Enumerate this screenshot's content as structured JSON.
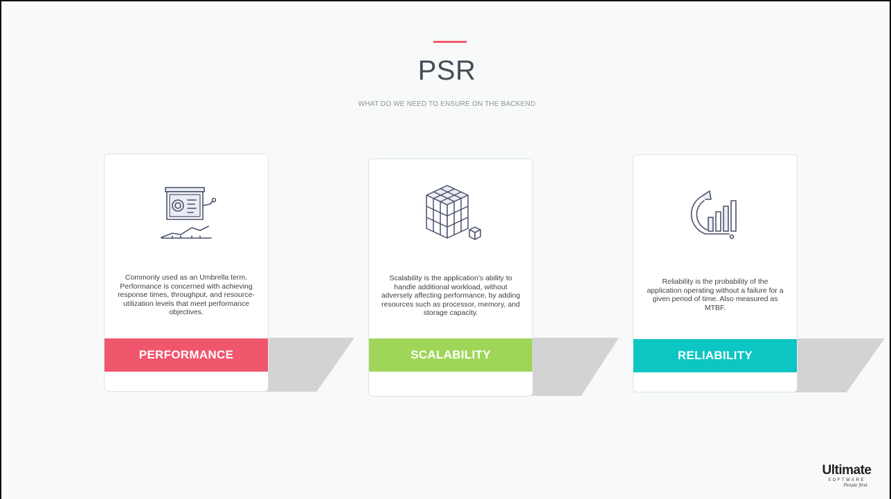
{
  "header": {
    "title": "PSR",
    "subtitle": "WHAT DO WE NEED TO ENSURE ON THE BACKEND",
    "accent_color": "#f0596e"
  },
  "cards": [
    {
      "label": "PERFORMANCE",
      "icon": "presentation-board-icon",
      "color": "#f0566c",
      "description": "Commonly used as an Umbrella term. Performance is concerned with achieving response times, throughput, and resource-utilization levels that meet performance objectives."
    },
    {
      "label": "SCALABILITY",
      "icon": "cube-grid-icon",
      "color": "#9fd65a",
      "description": "Scalability is the application’s ability to handle additional workload, without adversely affecting performance, by adding resources such as processor, memory, and storage capacity."
    },
    {
      "label": "RELIABILITY",
      "icon": "growth-chart-icon",
      "color": "#0cc6c3",
      "description": "Reliability is the probability of the application operating without a failure for a given period of time. Also measured as MTBF."
    }
  ],
  "logo": {
    "brand": "Ultimate",
    "sub": "SOFTWARE",
    "tagline": "People first"
  }
}
